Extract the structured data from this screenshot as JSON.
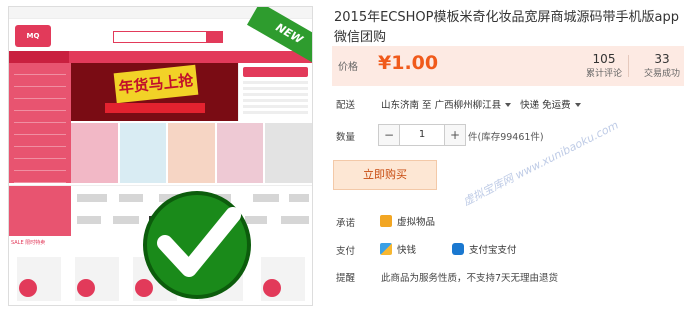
{
  "preview": {
    "new_badge": "NEW",
    "banner_text": "年货马上抢",
    "sale_title": "SALE 限时特卖"
  },
  "product": {
    "title": "2015年ECSHOP模板米奇化妆品宽屏商城源码带手机版app微信团购",
    "price_label": "价格",
    "price": "¥1.00",
    "reviews_count": "105",
    "reviews_label": "累计评论",
    "trades_count": "33",
    "trades_label": "交易成功"
  },
  "delivery": {
    "label": "配送",
    "from": "山东济南 至",
    "to": "广西柳州柳江县",
    "method": "快递 免运费"
  },
  "quantity": {
    "label": "数量",
    "minus": "−",
    "value": "1",
    "plus": "+",
    "stock": "件(库存99461件)"
  },
  "buy_button": "立即购买",
  "watermark": "虚拟宝库网 www.xunibaoku.com",
  "services": {
    "commit_label": "承诺",
    "commit_value": "虚拟物品",
    "pay_label": "支付",
    "pay_methods": [
      "快钱",
      "支付宝支付"
    ],
    "tip_label": "提醒",
    "tip_text": "此商品为服务性质，不支持7天无理由退货"
  },
  "colors": {
    "accent": "#f05a1b",
    "price_bg": "#fdeae3",
    "preview_brand": "#e23a5a"
  }
}
